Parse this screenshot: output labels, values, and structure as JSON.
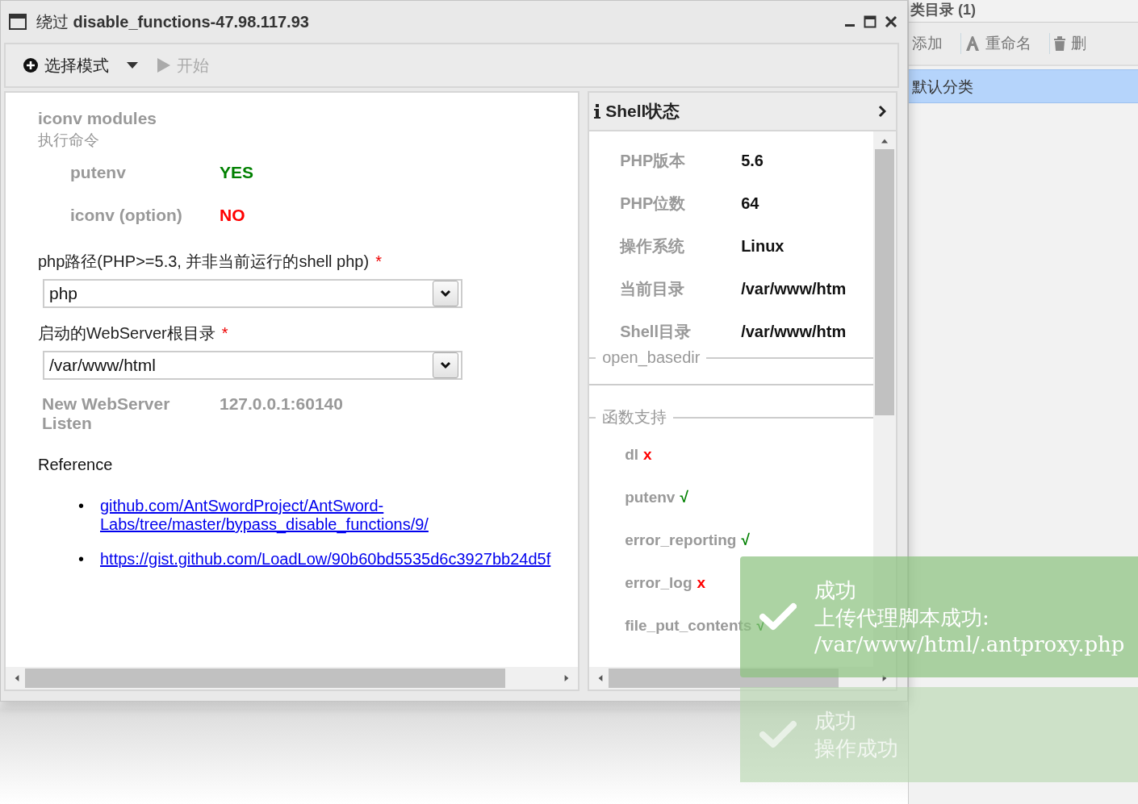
{
  "window": {
    "title_prefix": "绕过",
    "title": "disable_functions-47.98.117.93"
  },
  "toolbar": [
    {
      "kind": "dropdown",
      "label": "选择模式",
      "disabled": false
    },
    {
      "kind": "play",
      "label": "开始",
      "disabled": true
    }
  ],
  "module": {
    "title": "iconv modules",
    "subtitle": "执行命令",
    "checks": [
      {
        "name": "putenv",
        "result": "YES",
        "ok": true
      },
      {
        "name": "iconv (option)",
        "result": "NO",
        "ok": false
      }
    ]
  },
  "fields": [
    {
      "label": "php路径(PHP>=5.3, 并非当前运行的shell php)",
      "required_mark": "*",
      "value": "php"
    },
    {
      "label": "启动的WebServer根目录",
      "required_mark": "*",
      "value": "/var/www/html"
    }
  ],
  "listen": {
    "label": "New WebServer Listen",
    "value": "127.0.0.1:60140"
  },
  "reference": {
    "title": "Reference",
    "links": [
      {
        "bullet": "•",
        "text": "github.com/AntSwordProject/AntSword-Labs/tree/master/bypass_disable_functions/9/"
      },
      {
        "bullet": "•",
        "text": "https://gist.github.com/LoadLow/90b60bd5535d6c3927bb24d5f"
      }
    ]
  },
  "shell_status": {
    "title": "Shell状态",
    "info": [
      {
        "label": "PHP版本",
        "value": "5.6"
      },
      {
        "label": "PHP位数",
        "value": "64"
      },
      {
        "label": "操作系统",
        "value": "Linux"
      },
      {
        "label": "当前目录",
        "value": "/var/www/htm"
      },
      {
        "label": "Shell目录",
        "value": "/var/www/htm"
      }
    ],
    "open_basedir_legend": "open_basedir",
    "functions_legend": "函数支持",
    "functions": [
      {
        "name": "dl",
        "mark": "x",
        "ok": false
      },
      {
        "name": "putenv",
        "mark": "√",
        "ok": true
      },
      {
        "name": "error_reporting",
        "mark": "√",
        "ok": true
      },
      {
        "name": "error_log",
        "mark": "x",
        "ok": false
      },
      {
        "name": "file_put_contents",
        "mark": "√",
        "ok": true
      }
    ]
  },
  "category_panel": {
    "title": "类目录 (1)",
    "toolbar": [
      {
        "kind": "add",
        "label": "添加"
      },
      {
        "kind": "rename",
        "label": "重命名"
      },
      {
        "kind": "delete",
        "label": "删"
      }
    ],
    "items": [
      {
        "label": "默认分类",
        "selected": true
      }
    ]
  },
  "toasts": [
    {
      "title": "成功",
      "lines": [
        "上传代理脚本成功:",
        "/var/www/html/.antproxy.php"
      ],
      "faded": false
    },
    {
      "title": "成功",
      "lines": [
        "操作成功"
      ],
      "faded": true
    }
  ]
}
